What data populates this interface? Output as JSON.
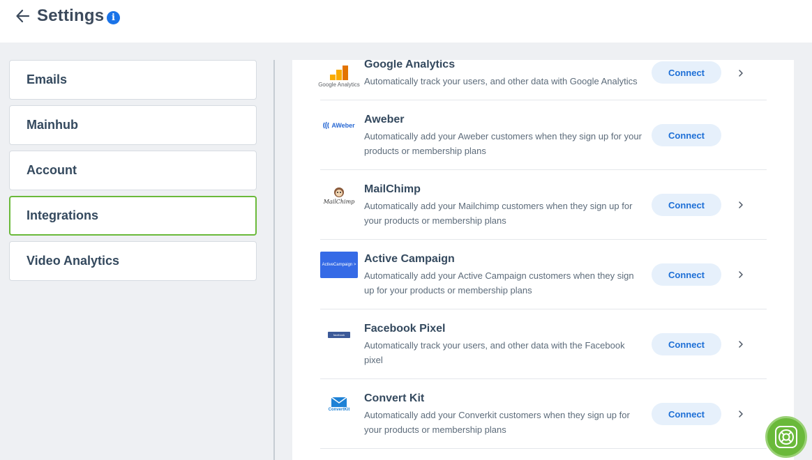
{
  "header": {
    "title": "Settings",
    "back_icon": "arrow-left-icon",
    "info_icon": "info-icon",
    "info_glyph": "i"
  },
  "sidebar": {
    "items": [
      {
        "label": "Emails",
        "active": false
      },
      {
        "label": "Mainhub",
        "active": false
      },
      {
        "label": "Account",
        "active": false
      },
      {
        "label": "Integrations",
        "active": true
      },
      {
        "label": "Video Analytics",
        "active": false
      }
    ]
  },
  "integrations": [
    {
      "name": "Google Analytics",
      "description": "Automatically track your users, and other data with Google Analytics",
      "logo_text": "Google Analytics",
      "logo_icon": "google-analytics-logo",
      "connect_label": "Connect",
      "has_chevron": true
    },
    {
      "name": "Aweber",
      "description": "Automatically add your Aweber customers when they sign up for your products or membership plans",
      "logo_text": "AWeber",
      "logo_icon": "aweber-logo",
      "connect_label": "Connect",
      "has_chevron": false
    },
    {
      "name": "MailChimp",
      "description": "Automatically add your Mailchimp customers when they sign up for your products or membership plans",
      "logo_text": "MailChimp",
      "logo_icon": "mailchimp-logo",
      "connect_label": "Connect",
      "has_chevron": true
    },
    {
      "name": "Active Campaign",
      "description": "Automatically add your Active Campaign customers when they sign up for your products or membership plans",
      "logo_text": "ActiveCampaign >",
      "logo_icon": "activecampaign-logo",
      "connect_label": "Connect",
      "has_chevron": true
    },
    {
      "name": "Facebook Pixel",
      "description": "Automatically track your users, and other data with the Facebook pixel",
      "logo_text": "facebook",
      "logo_icon": "facebook-pixel-logo",
      "connect_label": "Connect",
      "has_chevron": true
    },
    {
      "name": "Convert Kit",
      "description": "Automatically add your Converkit customers when they sign up for your products or membership plans",
      "logo_text": "ConvertKit",
      "logo_icon": "convertkit-logo",
      "connect_label": "Connect",
      "has_chevron": true
    }
  ],
  "help_widget": {
    "icon": "lifebuoy-icon"
  },
  "colors": {
    "accent_blue": "#1d6fd6",
    "connect_bg": "#e6f0fb",
    "active_border": "#6ab93a",
    "help_green": "#6ab93a",
    "info_blue": "#1a73e8"
  }
}
